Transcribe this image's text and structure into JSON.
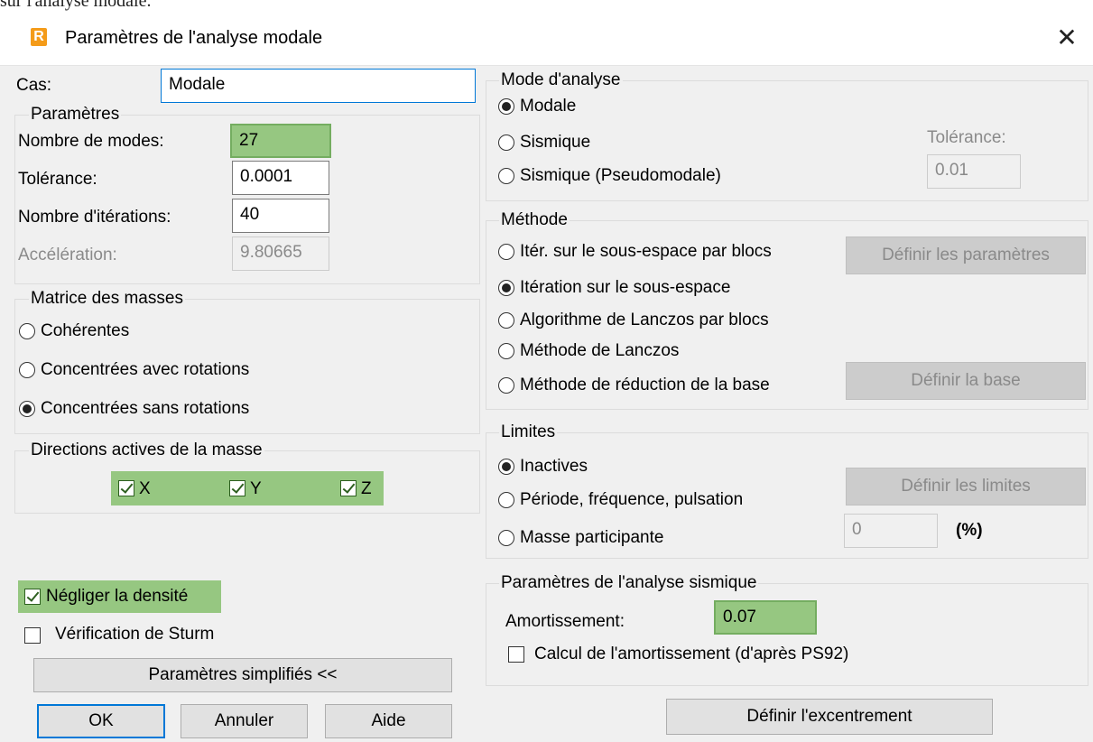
{
  "top_fragment": "sur l'analyse modale.",
  "window": {
    "title": "Paramètres de l'analyse modale",
    "logo_letter": "R",
    "logo_color": "#f49b19",
    "highlight_color": "#96c781"
  },
  "case": {
    "label": "Cas:",
    "value": "Modale"
  },
  "parameters": {
    "legend": "Paramètres",
    "modes_label": "Nombre de modes:",
    "modes_value": "27",
    "tolerance_label": "Tolérance:",
    "tolerance_value": "0.0001",
    "iterations_label": "Nombre d'itérations:",
    "iterations_value": "40",
    "acceleration_label": "Accélération:",
    "acceleration_value": "9.80665"
  },
  "mass_matrix": {
    "legend": "Matrice des masses",
    "options": [
      "Cohérentes",
      "Concentrées avec rotations",
      "Concentrées sans rotations"
    ],
    "selected": "Concentrées sans rotations"
  },
  "mass_directions": {
    "legend": "Directions actives de la masse",
    "x": "X",
    "y": "Y",
    "z": "Z"
  },
  "neglect_density": {
    "label": "Négliger la densité",
    "checked": true
  },
  "sturm": {
    "label": "Vérification de Sturm",
    "checked": false
  },
  "buttons": {
    "simplified": "Paramètres simplifiés <<",
    "ok": "OK",
    "cancel": "Annuler",
    "help": "Aide",
    "define_params": "Définir les paramètres",
    "define_base": "Définir la base",
    "define_limits": "Définir les limites",
    "define_eccentricity": "Définir l'excentrement"
  },
  "analysis_mode": {
    "legend": "Mode d'analyse",
    "options": [
      "Modale",
      "Sismique",
      "Sismique (Pseudomodale)"
    ],
    "selected": "Modale",
    "tolerance_label": "Tolérance:",
    "tolerance_value": "0.01"
  },
  "method": {
    "legend": "Méthode",
    "options": [
      "Itér. sur le sous-espace par blocs",
      "Itération sur le sous-espace",
      "Algorithme de Lanczos par blocs",
      "Méthode de Lanczos",
      "Méthode de réduction de la base"
    ],
    "selected": "Itération sur le sous-espace"
  },
  "limits": {
    "legend": "Limites",
    "options": [
      "Inactives",
      "Période, fréquence, pulsation",
      "Masse participante"
    ],
    "selected": "Inactives",
    "mass_value": "0",
    "unit": "(%)"
  },
  "seismic": {
    "legend": "Paramètres de l'analyse sismique",
    "damping_label": "Amortissement:",
    "damping_value": "0.07",
    "calc_damping_label": "Calcul de l'amortissement (d'après PS92)"
  }
}
